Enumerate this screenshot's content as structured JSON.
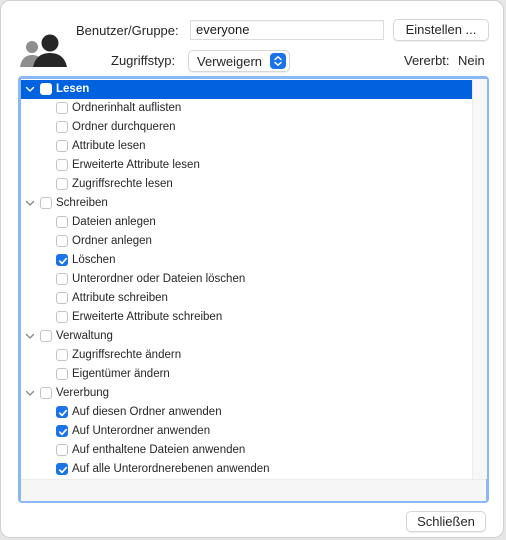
{
  "header": {
    "user_group_label": "Benutzer/Gruppe:",
    "user_group_value": "everyone",
    "set_button": "Einstellen ...",
    "access_type_label": "Zugriffstyp:",
    "access_type_value": "Verweigern",
    "inherited_label": "Vererbt:",
    "inherited_value": "Nein",
    "avatar_icon": "user-group-icon"
  },
  "tree": {
    "groups": [
      {
        "label": "Lesen",
        "checked": false,
        "expanded": true,
        "selected": true,
        "items": [
          {
            "label": "Ordnerinhalt auflisten",
            "checked": false
          },
          {
            "label": "Ordner durchqueren",
            "checked": false
          },
          {
            "label": "Attribute lesen",
            "checked": false
          },
          {
            "label": "Erweiterte Attribute lesen",
            "checked": false
          },
          {
            "label": "Zugriffsrechte lesen",
            "checked": false
          }
        ]
      },
      {
        "label": "Schreiben",
        "checked": false,
        "expanded": true,
        "selected": false,
        "items": [
          {
            "label": "Dateien anlegen",
            "checked": false
          },
          {
            "label": "Ordner anlegen",
            "checked": false
          },
          {
            "label": "Löschen",
            "checked": true
          },
          {
            "label": "Unterordner oder Dateien löschen",
            "checked": false
          },
          {
            "label": "Attribute schreiben",
            "checked": false
          },
          {
            "label": "Erweiterte Attribute schreiben",
            "checked": false
          }
        ]
      },
      {
        "label": "Verwaltung",
        "checked": false,
        "expanded": true,
        "selected": false,
        "items": [
          {
            "label": "Zugriffsrechte ändern",
            "checked": false
          },
          {
            "label": "Eigentümer ändern",
            "checked": false
          }
        ]
      },
      {
        "label": "Vererbung",
        "checked": false,
        "expanded": true,
        "selected": false,
        "items": [
          {
            "label": "Auf diesen Ordner anwenden",
            "checked": true
          },
          {
            "label": "Auf Unterordner anwenden",
            "checked": true
          },
          {
            "label": "Auf enthaltene Dateien anwenden",
            "checked": false
          },
          {
            "label": "Auf alle Unterordnerebenen anwenden",
            "checked": true
          }
        ]
      }
    ]
  },
  "footer": {
    "close_button": "Schließen"
  },
  "colors": {
    "accent": "#1a73e8",
    "selection": "#0162e0",
    "focus_ring": "#8cb7f5"
  }
}
